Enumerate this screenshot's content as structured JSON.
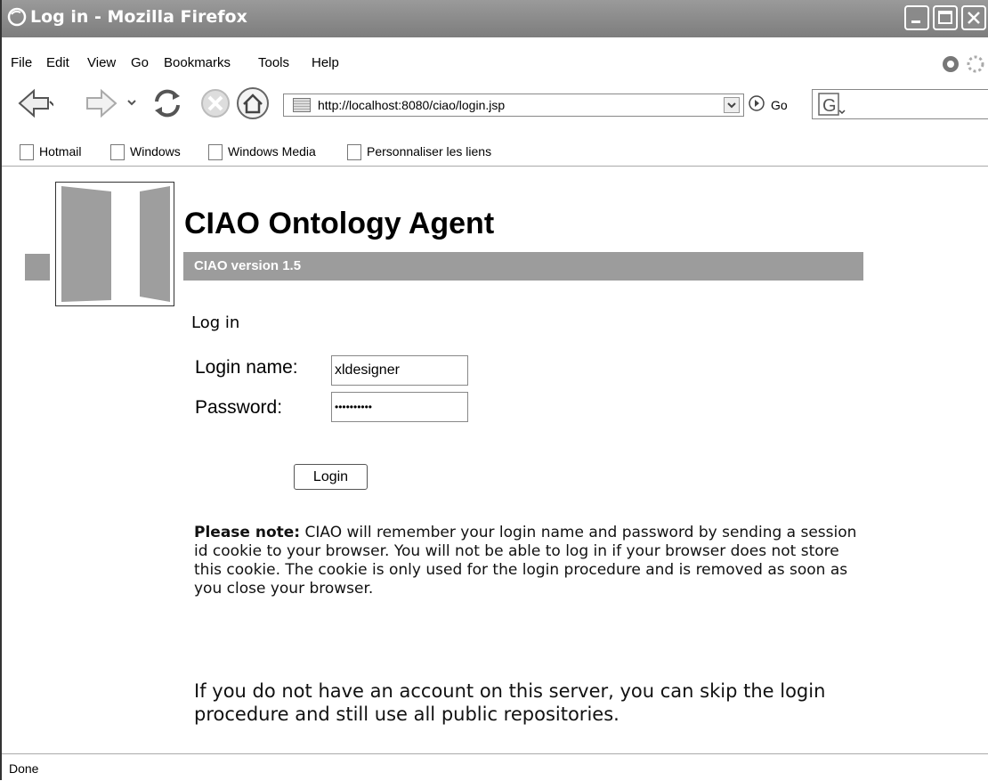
{
  "window": {
    "title": "Log in - Mozilla Firefox"
  },
  "menu": [
    "File",
    "Edit",
    "View",
    "Go",
    "Bookmarks",
    "Tools",
    "Help"
  ],
  "toolbar": {
    "url": "http://localhost:8080/ciao/login.jsp",
    "go_label": "Go"
  },
  "bookmarks": [
    "Hotmail",
    "Windows",
    "Windows Media",
    "Personnaliser les liens"
  ],
  "page": {
    "app_title": "CIAO Ontology Agent",
    "version": "CIAO version 1.5",
    "heading": "Log in",
    "login_label": "Login name:",
    "login_value": "xldesigner",
    "password_label": "Password:",
    "password_value": "••••••••••",
    "login_button": "Login",
    "note_bold": "Please note:",
    "note_text": " CIAO will remember your login name and password by sending a session id cookie to your browser. You will not be able to log in if your browser does not store this cookie. The cookie is only used for the login procedure and is removed as soon as you close your browser.",
    "info_text": "If you do not have an account on this server, you can skip the login procedure and still use all public repositories."
  },
  "status": {
    "text": "Done"
  },
  "colors": {
    "titlebar": "#8a8a8a",
    "banner": "#9c9c9c"
  }
}
